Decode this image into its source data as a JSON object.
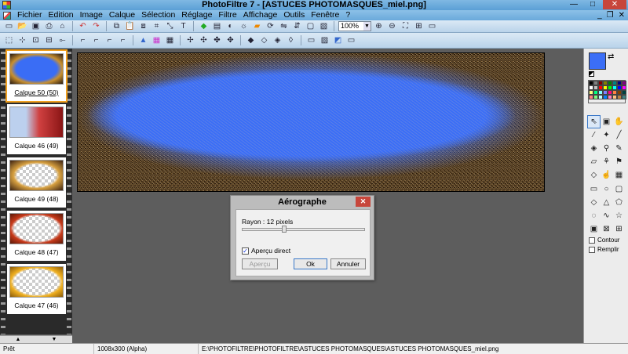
{
  "window": {
    "title": "PhotoFiltre 7 - [ASTUCES PHOTOMASQUES_miel.png]",
    "minimize": "—",
    "maximize": "□",
    "close": "✕"
  },
  "menubar": {
    "items": [
      "Fichier",
      "Edition",
      "Image",
      "Calque",
      "Sélection",
      "Réglage",
      "Filtre",
      "Affichage",
      "Outils",
      "Fenêtre",
      "?"
    ],
    "mdi": [
      "_",
      "❐",
      "✕"
    ]
  },
  "toolbar1": {
    "icons": [
      "new-icon",
      "open-icon",
      "save-icon",
      "print-icon",
      "scan-icon",
      "undo-icon",
      "redo-icon",
      "copy-icon",
      "paste-icon",
      "paste-new-icon",
      "crop-icon",
      "resize-icon",
      "gradient-icon",
      "text-icon",
      "auto-icon",
      "level-icon",
      "contrast-icon",
      "brightness-icon",
      "rotate-icon"
    ],
    "zoom_value": "100%",
    "zoom_icons": [
      "zoom-in-icon",
      "zoom-out-icon",
      "fit-icon",
      "actual-size-icon",
      "fullscreen-icon"
    ]
  },
  "toolbar2": {
    "icons": [
      "filter-1-icon",
      "filter-2-icon",
      "filter-3-icon",
      "filter-4-icon",
      "filter-5-icon",
      "filter-6-icon",
      "filter-7-icon",
      "filter-8-icon",
      "filter-9-icon",
      "filter-10-icon",
      "filter-11-icon",
      "filter-12-icon",
      "filter-13-icon",
      "filter-14-icon",
      "filter-15-icon",
      "filter-16-icon",
      "filter-17-icon",
      "filter-18-icon",
      "filter-19-icon",
      "filter-20-icon",
      "filter-21-icon",
      "filter-22-icon",
      "filter-23-icon",
      "filter-24-icon"
    ]
  },
  "layers": [
    {
      "label": "Calque 50 (50)",
      "selected": true
    },
    {
      "label": "Calque 46 (49)",
      "selected": false
    },
    {
      "label": "Calque 49 (48)",
      "selected": false
    },
    {
      "label": "Calque 48 (47)",
      "selected": false
    },
    {
      "label": "Calque 47 (46)",
      "selected": false
    }
  ],
  "dialog": {
    "title": "Aérographe",
    "rayon_label": "Rayon : 12 pixels",
    "slider_value_fraction": 0.38,
    "apercu_direct_label": "Aperçu direct",
    "apercu_direct_checked": true,
    "apercu_button": "Aperçu",
    "ok_button": "Ok",
    "cancel_button": "Annuler"
  },
  "right_panel": {
    "foreground_color": "#3b6ef6",
    "background_color": "#ffffff",
    "palette": [
      "#000000",
      "#808080",
      "#800000",
      "#808000",
      "#008000",
      "#008080",
      "#000080",
      "#800080",
      "#ffffff",
      "#c0c0c0",
      "#ff0000",
      "#ffff00",
      "#00ff00",
      "#00ffff",
      "#0000ff",
      "#ff00ff",
      "#ffff80",
      "#00ff80",
      "#80ffff",
      "#8080ff",
      "#ff0080",
      "#ff8040",
      "#804000",
      "#004040",
      "#ff8080",
      "#80ff80",
      "#c0ffff",
      "#0080ff",
      "#ff80c0",
      "#ffc080",
      "#c08040",
      "#408080"
    ],
    "tools": [
      "select-icon",
      "layer-icon",
      "hand-icon",
      "picker-icon",
      "wand-icon",
      "line-icon",
      "fill-icon",
      "spray-icon",
      "brush-icon",
      "eraser-icon",
      "clone-icon",
      "stamp-icon",
      "drop-icon",
      "smudge-icon",
      "pattern-icon"
    ],
    "shapes": [
      "rectangle-icon",
      "ellipse-icon",
      "rounded-rect-icon",
      "diamond-icon",
      "triangle-icon",
      "polygon-icon",
      "lasso-icon",
      "bezier-icon",
      "star-icon",
      "pattern-rect-icon",
      "stamp-rect-icon",
      "grid-icon"
    ],
    "contour_label": "Contour",
    "remplir_label": "Remplir"
  },
  "status": {
    "state": "Prêt",
    "size": "1008x300 (Alpha)",
    "path": "E:\\PHOTOFILTRE\\PHOTOFILTRE\\ASTUCES PHOTOMASQUES\\ASTUCES PHOTOMASQUES_miel.png"
  }
}
